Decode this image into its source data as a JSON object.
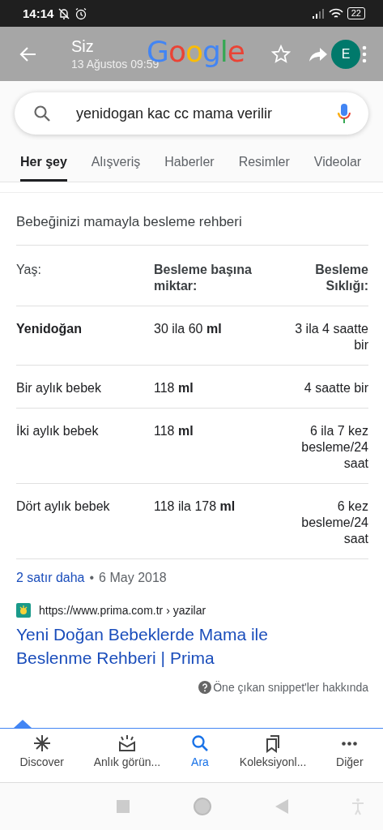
{
  "status_bar": {
    "time": "14:14",
    "battery": "22"
  },
  "app_bar": {
    "title": "Siz",
    "subtitle": "13 Ağustos 09:59",
    "logo": "Google",
    "avatar": "E"
  },
  "search": {
    "value": "yenidogan kac cc mama verilir"
  },
  "tabs": [
    {
      "label": "Her şey",
      "selected": true
    },
    {
      "label": "Alışveriş",
      "selected": false
    },
    {
      "label": "Haberler",
      "selected": false
    },
    {
      "label": "Resimler",
      "selected": false
    },
    {
      "label": "Videolar",
      "selected": false
    }
  ],
  "snippet": {
    "heading": "Bebeğinizi mamayla besleme rehberi",
    "columns": [
      "Yaş:",
      "Besleme başına miktar:",
      "Besleme Sıklığı:"
    ],
    "rows": [
      {
        "cells": [
          "Yenidoğan",
          "30 ila 60 **ml**",
          "3 ila 4 saatte bir"
        ],
        "emphasis": true
      },
      {
        "cells": [
          "Bir aylık bebek",
          "118 **ml**",
          "4 saatte bir"
        ],
        "emphasis": false
      },
      {
        "cells": [
          "İki aylık bebek",
          "118 **ml**",
          "6 ila 7 kez besleme/24 saat"
        ],
        "emphasis": false
      },
      {
        "cells": [
          "Dört aylık bebek",
          "118 ila 178 **ml**",
          "6 kez besleme/24 saat"
        ],
        "emphasis": false
      }
    ],
    "more_link": "2 satır daha",
    "separator": "•",
    "date": "6 May 2018",
    "source_url": "https://www.prima.com.tr › yazilar",
    "result_title": "Yeni Doğan Bebeklerde Mama ile Beslenme Rehberi | Prima",
    "about": "Öne çıkan snippet'ler hakkında"
  },
  "bottom_nav": [
    {
      "label": "Discover",
      "kind": "discover",
      "selected": false
    },
    {
      "label": "Anlık görün...",
      "kind": "snapshot",
      "selected": false
    },
    {
      "label": "Ara",
      "kind": "search",
      "selected": true
    },
    {
      "label": "Koleksiyonl...",
      "kind": "collections",
      "selected": false
    },
    {
      "label": "Diğer",
      "kind": "more",
      "selected": false
    }
  ]
}
